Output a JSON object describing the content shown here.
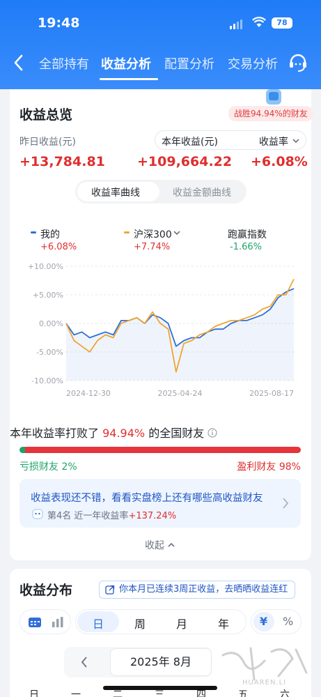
{
  "status_bar": {
    "time": "19:48",
    "battery": "78"
  },
  "nav": {
    "tabs": [
      "全部持有",
      "收益分析",
      "配置分析",
      "交易分析"
    ],
    "active_index": 1
  },
  "overview": {
    "title": "收益总览",
    "badge": "战胜94.94%的财友",
    "yesterday_label": "昨日收益(元)",
    "yesterday_value": "+13,784.81",
    "year_label": "本年收益(元)",
    "year_value": "+109,664.22",
    "rate_label": "收益率",
    "rate_value": "+6.08%"
  },
  "curve_toggle": {
    "options": [
      "收益率曲线",
      "收益金额曲线"
    ],
    "active_index": 0
  },
  "legend": [
    {
      "name": "我的",
      "value": "+6.08%",
      "color": "#2f6fd6"
    },
    {
      "name": "沪深300",
      "value": "+7.74%",
      "color": "#f0a431"
    },
    {
      "name": "跑赢指数",
      "value": "-1.66%",
      "color": "#1ea36a"
    }
  ],
  "chart_data": {
    "type": "line",
    "y_ticks": [
      "+10.00%",
      "+5.00%",
      "0.00%",
      "-5.00%",
      "-10.00%"
    ],
    "ylim": [
      -10,
      10
    ],
    "x_ticks": [
      "2024-12-30",
      "2025-04-24",
      "2025-08-17"
    ],
    "series": [
      {
        "name": "我的",
        "color": "#2f6fd6",
        "values": [
          0,
          -2,
          -1.5,
          -2.5,
          -2,
          -1.5,
          -2,
          0.5,
          0.5,
          1,
          0,
          1.5,
          1,
          0,
          -4,
          -3,
          -2.5,
          -2.5,
          -1.5,
          -1,
          -1,
          0,
          0.5,
          0.5,
          1,
          1.5,
          2.5,
          4.5,
          5.5,
          6.08
        ]
      },
      {
        "name": "沪深300",
        "color": "#f0a431",
        "values": [
          0,
          -3,
          -4,
          -5,
          -3,
          -2,
          -2.5,
          0,
          0.5,
          1,
          0,
          2,
          0,
          -1,
          -8.5,
          -3.5,
          -3,
          -2,
          -1.5,
          -0.5,
          0,
          0.5,
          0.5,
          1,
          1.5,
          2.5,
          3,
          5,
          5,
          7.74
        ]
      }
    ]
  },
  "beat": {
    "prefix": "本年收益率打败了",
    "percent": "94.94%",
    "suffix": "的全国财友"
  },
  "loss_win": {
    "loss_label": "亏损财友 2%",
    "win_label": "盈利财友 98%",
    "loss_share": 0.02
  },
  "promo": {
    "text": "收益表现还不错，看看实盘榜上还有哪些高收益财友",
    "rank": "第4名",
    "rank_desc": "近一年收益率",
    "rank_value": "+137.24%"
  },
  "collapse_label": "收起",
  "distribution": {
    "title": "收益分布",
    "streak": "你本月已连续3周正收益，去晒晒收益连红",
    "periods": [
      "日",
      "周",
      "月",
      "年"
    ],
    "active_period": 0,
    "currency": [
      "¥",
      "%"
    ],
    "month": "2025年 8月",
    "weekdays": [
      "日",
      "一",
      "二",
      "三",
      "四",
      "五",
      "六"
    ]
  },
  "watermark": "HUAREN.LI"
}
